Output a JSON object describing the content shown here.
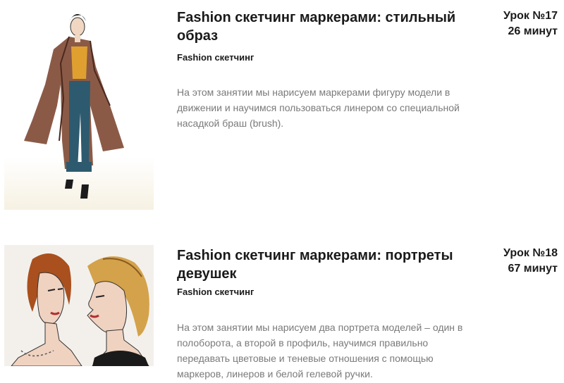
{
  "lessons": [
    {
      "title": "Fashion скетчинг маркерами: стильный образ",
      "category": "Fashion скетчинг",
      "lesson_number": "Урок №17",
      "duration": "26 минут",
      "description": "На этом занятии мы нарисуем маркерами фигуру модели в движении и научимся пользоваться линером со специальной насадкой браш (brush).",
      "image": "fashion-figure-sketch"
    },
    {
      "title": "Fashion скетчинг маркерами: портреты девушек",
      "category": "Fashion скетчинг",
      "lesson_number": "Урок №18",
      "duration": "67 минут",
      "description": "На этом занятии мы нарисуем два портрета моделей – один в полоборота, а второй в профиль, научимся правильно передавать цветовые и теневые отношения с помощью маркеров, линеров и белой гелевой ручки.",
      "image": "two-female-portraits-sketch"
    }
  ]
}
